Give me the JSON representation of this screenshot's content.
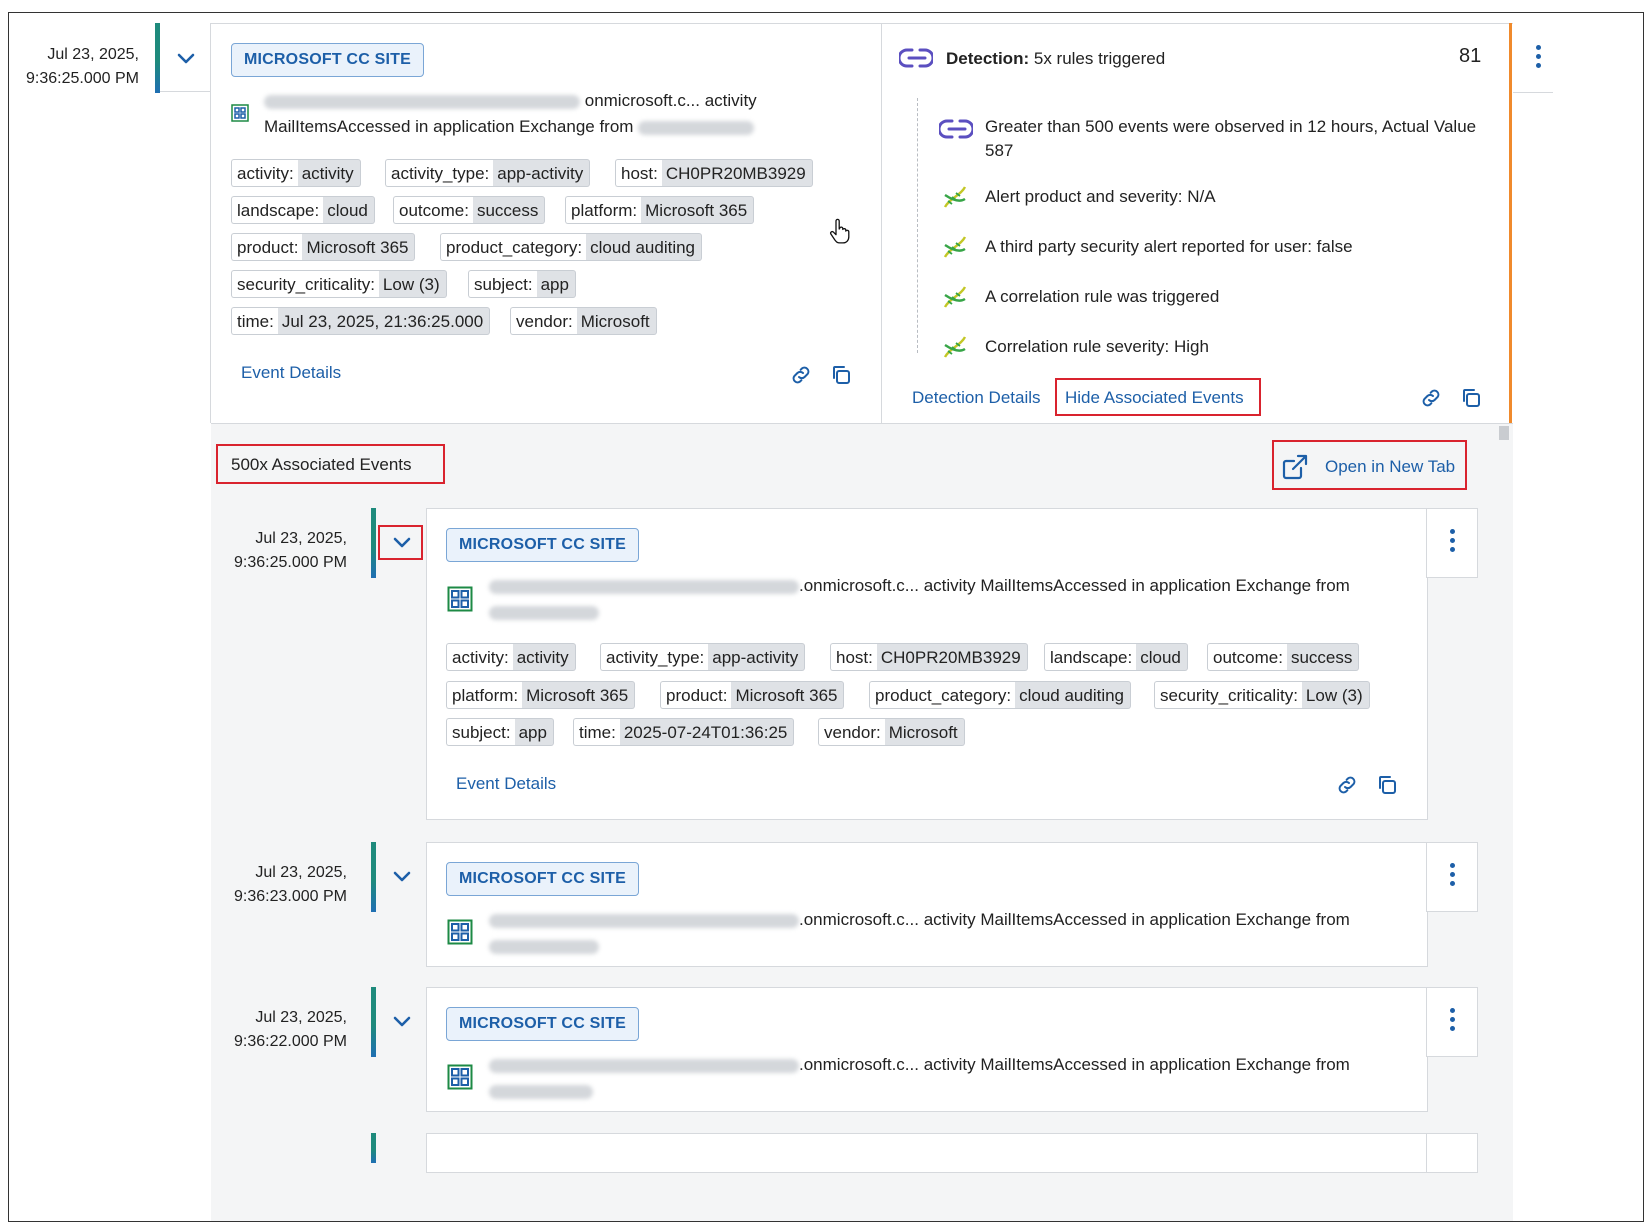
{
  "main_event": {
    "timestamp_line1": "Jul 23, 2025,",
    "timestamp_line2": "9:36:25.000 PM",
    "site_badge": "MICROSOFT CC SITE",
    "desc_line1_suffix": "onmicrosoft.c... activity",
    "desc_line2": "MailItemsAccessed in application Exchange from",
    "tags": [
      {
        "k": "activity:",
        "v": "activity"
      },
      {
        "k": "activity_type:",
        "v": "app-activity"
      },
      {
        "k": "host:",
        "v": "CH0PR20MB3929"
      },
      {
        "k": "landscape:",
        "v": "cloud"
      },
      {
        "k": "outcome:",
        "v": "success"
      },
      {
        "k": "platform:",
        "v": "Microsoft 365"
      },
      {
        "k": "product:",
        "v": "Microsoft 365"
      },
      {
        "k": "product_category:",
        "v": "cloud auditing"
      },
      {
        "k": "security_criticality:",
        "v": "Low (3)"
      },
      {
        "k": "subject:",
        "v": "app"
      },
      {
        "k": "time:",
        "v": "Jul 23, 2025, 21:36:25.000"
      },
      {
        "k": "vendor:",
        "v": "Microsoft"
      }
    ],
    "event_details": "Event Details"
  },
  "detection": {
    "label": "Detection:",
    "summary": "5x rules triggered",
    "score": "81",
    "rules": [
      {
        "icon": "correlation-rule-icon",
        "text": "Greater than 500 events were observed in 12 hours, Actual Value 587"
      },
      {
        "icon": "dna-icon",
        "text": "Alert product and severity: N/A"
      },
      {
        "icon": "dna-icon",
        "text": "A third party security alert reported for user: false"
      },
      {
        "icon": "dna-icon",
        "text": "A correlation rule was triggered"
      },
      {
        "icon": "dna-icon",
        "text": "Correlation rule severity: High"
      }
    ],
    "details_link": "Detection Details",
    "hide_link": "Hide Associated Events"
  },
  "associated": {
    "title": "500x Associated Events",
    "open_new_tab": "Open in New Tab",
    "events": [
      {
        "timestamp_line1": "Jul 23, 2025,",
        "timestamp_line2": "9:36:25.000 PM",
        "site_badge": "MICROSOFT CC SITE",
        "desc": ".onmicrosoft.c... activity MailItemsAccessed in application Exchange from",
        "tags": [
          {
            "k": "activity:",
            "v": "activity"
          },
          {
            "k": "activity_type:",
            "v": "app-activity"
          },
          {
            "k": "host:",
            "v": "CH0PR20MB3929"
          },
          {
            "k": "landscape:",
            "v": "cloud"
          },
          {
            "k": "outcome:",
            "v": "success"
          },
          {
            "k": "platform:",
            "v": "Microsoft 365"
          },
          {
            "k": "product:",
            "v": "Microsoft 365"
          },
          {
            "k": "product_category:",
            "v": "cloud auditing"
          },
          {
            "k": "security_criticality:",
            "v": "Low (3)"
          },
          {
            "k": "subject:",
            "v": "app"
          },
          {
            "k": "time:",
            "v": "2025-07-24T01:36:25"
          },
          {
            "k": "vendor:",
            "v": "Microsoft"
          }
        ],
        "event_details": "Event Details"
      },
      {
        "timestamp_line1": "Jul 23, 2025,",
        "timestamp_line2": "9:36:23.000 PM",
        "site_badge": "MICROSOFT CC SITE",
        "desc": ".onmicrosoft.c... activity MailItemsAccessed in application Exchange from"
      },
      {
        "timestamp_line1": "Jul 23, 2025,",
        "timestamp_line2": "9:36:22.000 PM",
        "site_badge": "MICROSOFT CC SITE",
        "desc": ".onmicrosoft.c... activity MailItemsAccessed in application Exchange from"
      }
    ]
  },
  "colors": {
    "accent_blue": "#1d5fa8",
    "highlight_red": "#d9232e",
    "orange_rail": "#f08a2c",
    "teal_rail": "#1e8a7c"
  }
}
